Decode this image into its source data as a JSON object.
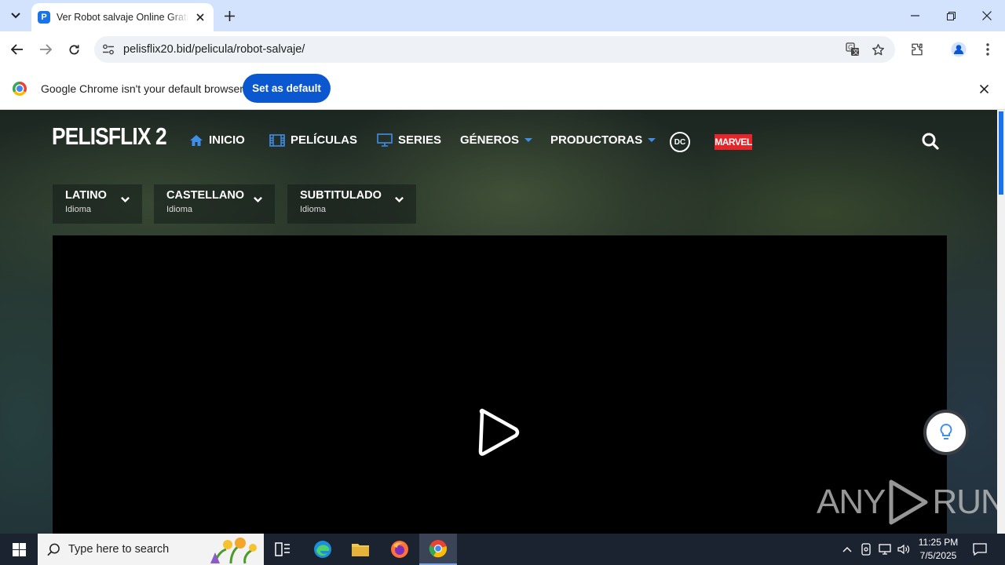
{
  "browser": {
    "tab_title": "Ver Robot salvaje Online Gratis",
    "favicon_letter": "P",
    "url": "pelisflix20.bid/pelicula/robot-salvaje/"
  },
  "infobar": {
    "message": "Google Chrome isn't your default browser",
    "button_label": "Set as default"
  },
  "site": {
    "logo": "PELISFLIX 2",
    "nav": [
      {
        "label": "INICIO",
        "icon": "home-icon"
      },
      {
        "label": "PELÍCULAS",
        "icon": "film-icon"
      },
      {
        "label": "SERIES",
        "icon": "tv-icon"
      },
      {
        "label": "GÉNEROS",
        "icon": "caret-down-icon"
      },
      {
        "label": "PRODUCTORAS",
        "icon": "caret-down-icon"
      }
    ],
    "dc_label": "DC",
    "marvel_label": "MARVEL",
    "languages": [
      {
        "name": "LATINO",
        "sub": "Idioma"
      },
      {
        "name": "CASTELLANO",
        "sub": "Idioma"
      },
      {
        "name": "SUBTITULADO",
        "sub": "Idioma"
      }
    ],
    "watermark_left": "ANY",
    "watermark_right": "RUN"
  },
  "taskbar": {
    "search_placeholder": "Type here to search",
    "time": "11:25 PM",
    "date": "7/5/2025"
  },
  "colors": {
    "accent": "#0b57d0",
    "nav_icon": "#3f8ee8",
    "marvel": "#e62429"
  }
}
